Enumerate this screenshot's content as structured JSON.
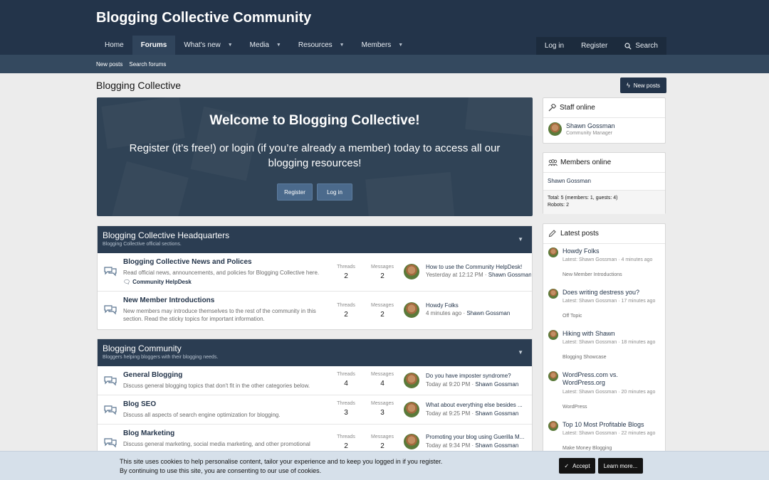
{
  "site": {
    "title": "Blogging Collective Community"
  },
  "nav": {
    "home": "Home",
    "forums": "Forums",
    "whats_new": "What's new",
    "media": "Media",
    "resources": "Resources",
    "members": "Members",
    "login": "Log in",
    "register": "Register",
    "search": "Search"
  },
  "subnav": {
    "new_posts": "New posts",
    "search_forums": "Search forums"
  },
  "page": {
    "title": "Blogging Collective",
    "new_posts_button": "New posts"
  },
  "welcome": {
    "title": "Welcome to Blogging Collective!",
    "text": "Register (it’s free!) or login (if you’re already a member) today to access all our blogging resources!",
    "register_button": "Register",
    "login_button": "Log in"
  },
  "categories": [
    {
      "title": "Blogging Collective Headquarters",
      "description": "Blogging Collective official sections.",
      "forums": [
        {
          "title": "Blogging Collective News and Polices",
          "description": "Read official news, announcements, and policies for Blogging Collective here.",
          "subforum": "Community HelpDesk",
          "threads_label": "Threads",
          "threads": "2",
          "messages_label": "Messages",
          "messages": "2",
          "last_title": "How to use the Community HelpDesk!",
          "last_time": "Yesterday at 12:12 PM",
          "last_user": "Shawn Gossman"
        },
        {
          "title": "New Member Introductions",
          "description": "New members may introduce themselves to the rest of the community in this section. Read the sticky topics for important information.",
          "threads_label": "Threads",
          "threads": "2",
          "messages_label": "Messages",
          "messages": "2",
          "last_title": "Howdy Folks",
          "last_time": "4 minutes ago",
          "last_user": "Shawn Gossman"
        }
      ]
    },
    {
      "title": "Blogging Community",
      "description": "Bloggers helping bloggers with their blogging needs.",
      "forums": [
        {
          "title": "General Blogging",
          "description": "Discuss general blogging topics that don't fit in the other categories below.",
          "threads_label": "Threads",
          "threads": "4",
          "messages_label": "Messages",
          "messages": "4",
          "last_title": "Do you have imposter syndrome?",
          "last_time": "Today at 9:20 PM",
          "last_user": "Shawn Gossman"
        },
        {
          "title": "Blog SEO",
          "description": "Discuss all aspects of search engine optimization for blogging.",
          "threads_label": "Threads",
          "threads": "3",
          "messages_label": "Messages",
          "messages": "3",
          "last_title": "What about everything else besides ...",
          "last_time": "Today at 9:25 PM",
          "last_user": "Shawn Gossman"
        },
        {
          "title": "Blog Marketing",
          "description": "Discuss general marketing, social media marketing, and other promotional",
          "threads_label": "Threads",
          "threads": "2",
          "messages_label": "Messages",
          "messages": "2",
          "last_title": "Promoting your blog using Guerilla M...",
          "last_time": "Today at 9:34 PM",
          "last_user": "Shawn Gossman"
        }
      ]
    }
  ],
  "sidebar": {
    "staff": {
      "title": "Staff online",
      "name": "Shawn Gossman",
      "role": "Community Manager"
    },
    "members_online": {
      "title": "Members online",
      "name": "Shawn Gossman",
      "total": "Total: 5 (members: 1, guests: 4)",
      "robots": "Robots: 2"
    },
    "latest_posts": {
      "title": "Latest posts",
      "items": [
        {
          "title": "Howdy Folks",
          "meta": "Latest: Shawn Gossman · 4 minutes ago",
          "forum": "New Member Introductions"
        },
        {
          "title": "Does writing destress you?",
          "meta": "Latest: Shawn Gossman · 17 minutes ago",
          "forum": "Off Topic"
        },
        {
          "title": "Hiking with Shawn",
          "meta": "Latest: Shawn Gossman · 18 minutes ago",
          "forum": "Blogging Showcase"
        },
        {
          "title": "WordPress.com vs. WordPress.org",
          "meta": "Latest: Shawn Gossman · 20 minutes ago",
          "forum": "WordPress"
        },
        {
          "title": "Top 10 Most Profitable Blogs",
          "meta": "Latest: Shawn Gossman · 22 minutes ago",
          "forum": "Make Money Blogging"
        }
      ]
    }
  },
  "cookie": {
    "line1": "This site uses cookies to help personalise content, tailor your experience and to keep you logged in if you register.",
    "line2": "By continuing to use this site, you are consenting to our use of cookies.",
    "accept": "Accept",
    "learn_more": "Learn more..."
  },
  "colors": {
    "header": "#23344a",
    "accent": "#30445b",
    "link": "#23344a"
  },
  "icons": [
    "search-icon",
    "lightning-icon",
    "hammer-icon",
    "users-icon",
    "pencil-icon",
    "chat-bubbles-icon",
    "check-icon",
    "chevron-down-icon"
  ]
}
